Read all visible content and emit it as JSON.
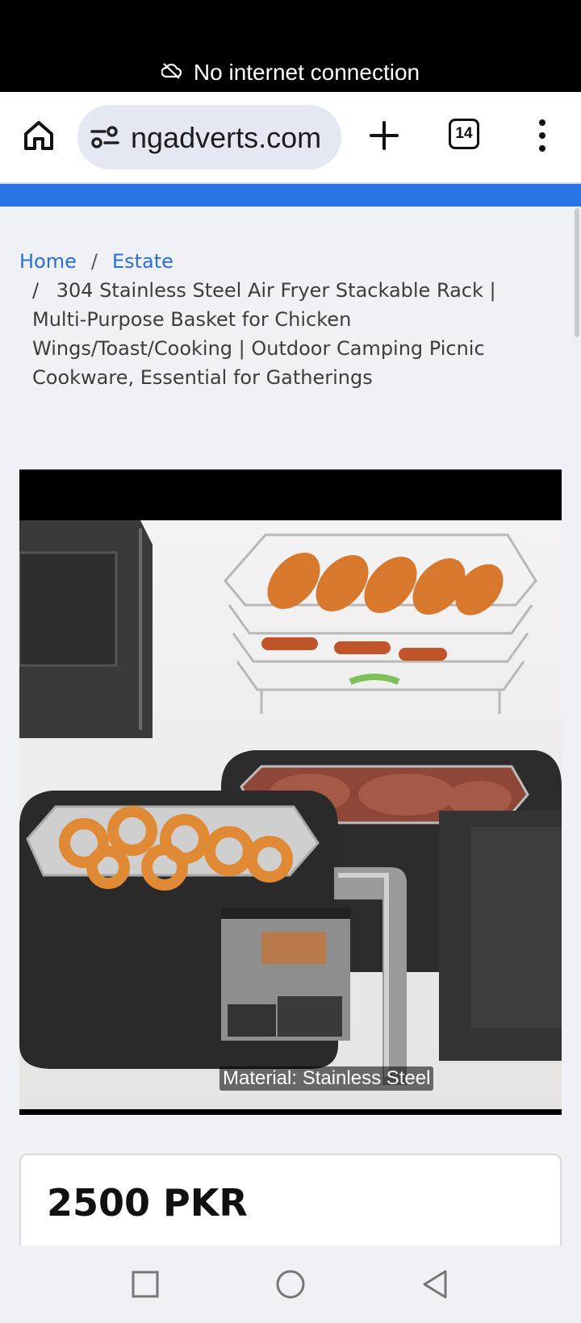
{
  "status_bar": {
    "message": "No internet connection",
    "icon": "cloud-off-icon"
  },
  "browser": {
    "url": "ngadverts.com",
    "tab_count": "14",
    "icons": [
      "home-icon",
      "site-settings-icon",
      "new-tab-icon",
      "tab-switcher-icon",
      "more-menu-icon"
    ],
    "accent_color": "#2b74e8"
  },
  "breadcrumb": {
    "home": "Home",
    "separator": "/",
    "category": "Estate",
    "current": "304 Stainless Steel Air Fryer Stackable Rack | Multi-Purpose Basket for Chicken Wings/Toast/Cooking | Outdoor Camping Picnic Cookware, Essential for Gatherings"
  },
  "product": {
    "image_caption": "Material: Stainless Steel",
    "price": "2500 PKR"
  },
  "nav_bar": {
    "icons": [
      "recents-icon",
      "home-circle-icon",
      "back-icon"
    ]
  }
}
